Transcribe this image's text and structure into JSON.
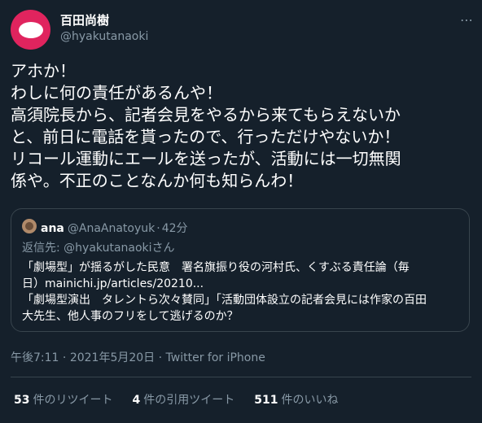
{
  "user": {
    "name": "百田尚樹",
    "handle": "@hyakutanaoki"
  },
  "tweet": {
    "lines": [
      "アホか！",
      "わしに何の責任があるんや！",
      "高須院長から、記者会見をやるから来てもらえないか",
      "と、前日に電話を貰ったので、行っただけやないか！",
      "リコール運動にエールを送ったが、活動には一切無関",
      "係や。不正のことなんか何も知らんわ！"
    ]
  },
  "quote": {
    "name": "ana",
    "handle": "@AnaAnatoyuk",
    "separator": "·",
    "time": "42分",
    "reply_to": "返信先: @hyakutanaokiさん",
    "lines": [
      "「劇場型」が揺るがした民意　署名旗振り役の河村氏、くすぶる責任論（毎",
      "日）mainichi.jp/articles/20210...",
      "「劇場型演出　タレントら次々賛同」「活動団体設立の記者会見には作家の百田",
      "大先生、他人事のフリをして逃げるのか？"
    ]
  },
  "meta": {
    "time": "午後7:11",
    "separator1": " · ",
    "date": "2021年5月20日",
    "separator2": " · ",
    "source": "Twitter for iPhone"
  },
  "stats": {
    "retweets": "53",
    "retweets_label": "件のリツイート",
    "quotes": "4",
    "quotes_label": "件の引用ツイート",
    "likes": "511",
    "likes_label": "件のいいね"
  },
  "icons": {
    "avatar": "avatar-icon",
    "more": "more-icon"
  },
  "colors": {
    "background": "#15202b",
    "avatar": "#e0245e",
    "secondary_text": "#8899a6",
    "border": "#38444d"
  }
}
